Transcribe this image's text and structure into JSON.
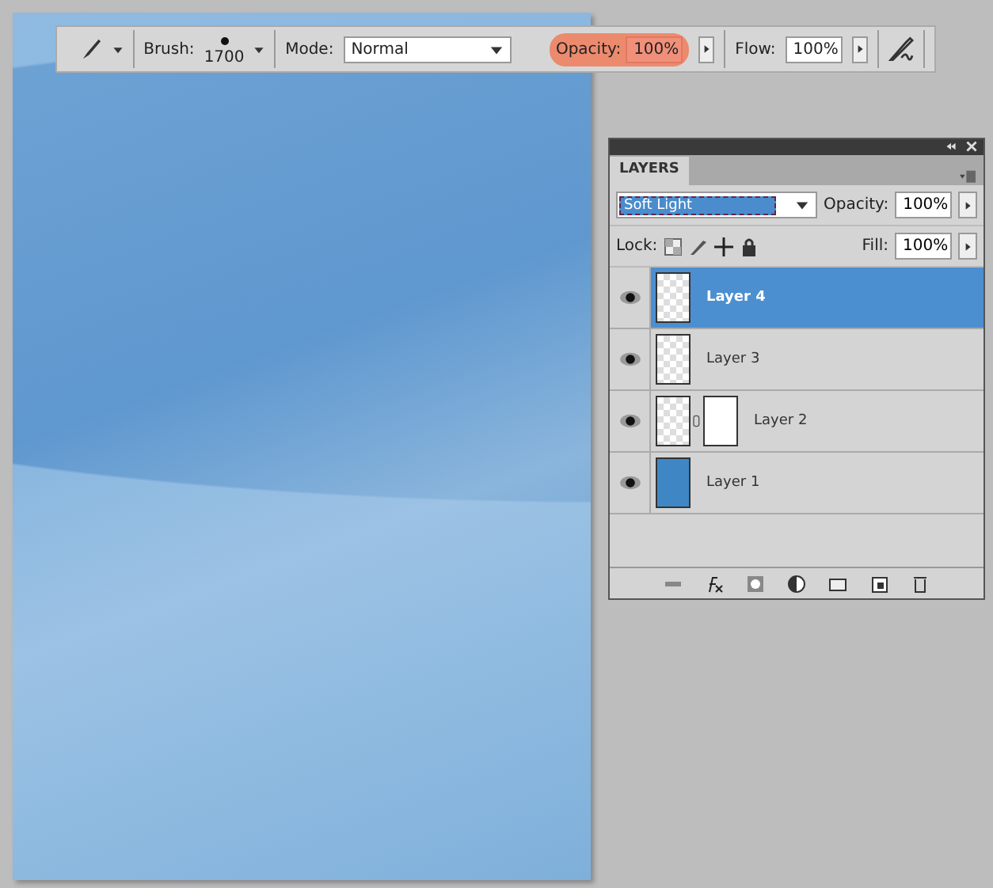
{
  "options_bar": {
    "brush_label": "Brush:",
    "brush_size": "1700",
    "mode_label": "Mode:",
    "mode_value": "Normal",
    "opacity_label": "Opacity:",
    "opacity_value": "100%",
    "opacity_highlighted": true,
    "flow_label": "Flow:",
    "flow_value": "100%"
  },
  "layers_panel": {
    "tab": "LAYERS",
    "blend_mode": "Soft Light",
    "opacity_label": "Opacity:",
    "opacity_value": "100%",
    "lock_label": "Lock:",
    "fill_label": "Fill:",
    "fill_value": "100%",
    "layers": [
      {
        "name": "Layer 4",
        "selected": true,
        "visible": true,
        "kind": "transparent",
        "mask": false
      },
      {
        "name": "Layer 3",
        "selected": false,
        "visible": true,
        "kind": "transparent",
        "mask": false
      },
      {
        "name": "Layer 2",
        "selected": false,
        "visible": true,
        "kind": "transparent",
        "mask": true
      },
      {
        "name": "Layer 1",
        "selected": false,
        "visible": true,
        "kind": "fill",
        "mask": false
      }
    ]
  }
}
